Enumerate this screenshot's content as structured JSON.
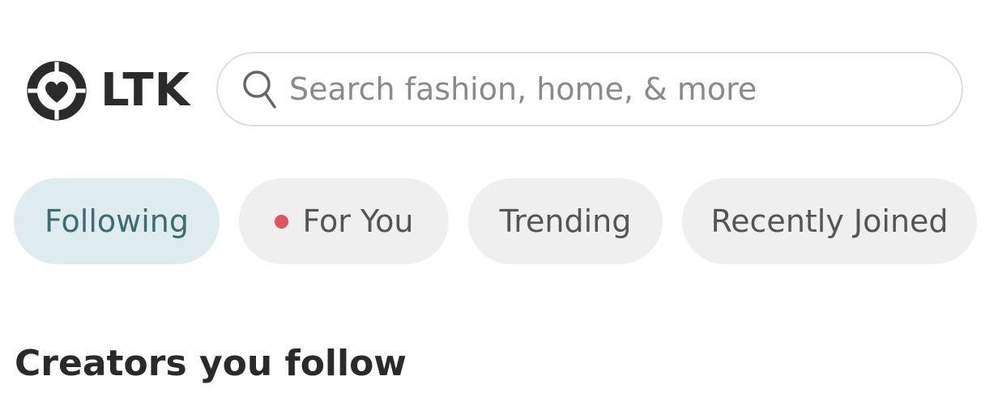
{
  "header": {
    "logo": {
      "text": "LTK",
      "icon": "ltk-logo-icon"
    },
    "search": {
      "placeholder": "Search fashion, home, & more",
      "icon": "search-icon"
    }
  },
  "tabs": [
    {
      "label": "Following",
      "active": true
    },
    {
      "label": "For You",
      "active": false,
      "indicator": "new-dot",
      "indicator_color": "#e2545f"
    },
    {
      "label": "Trending",
      "active": false
    },
    {
      "label": "Recently Joined",
      "active": false
    }
  ],
  "section": {
    "title": "Creators you follow"
  },
  "colors": {
    "active_tab_bg": "#deebef",
    "active_tab_text": "#3e6c72",
    "inactive_tab_bg": "#efefef",
    "dot": "#e2545f",
    "text_dark": "#2a2a2a"
  }
}
